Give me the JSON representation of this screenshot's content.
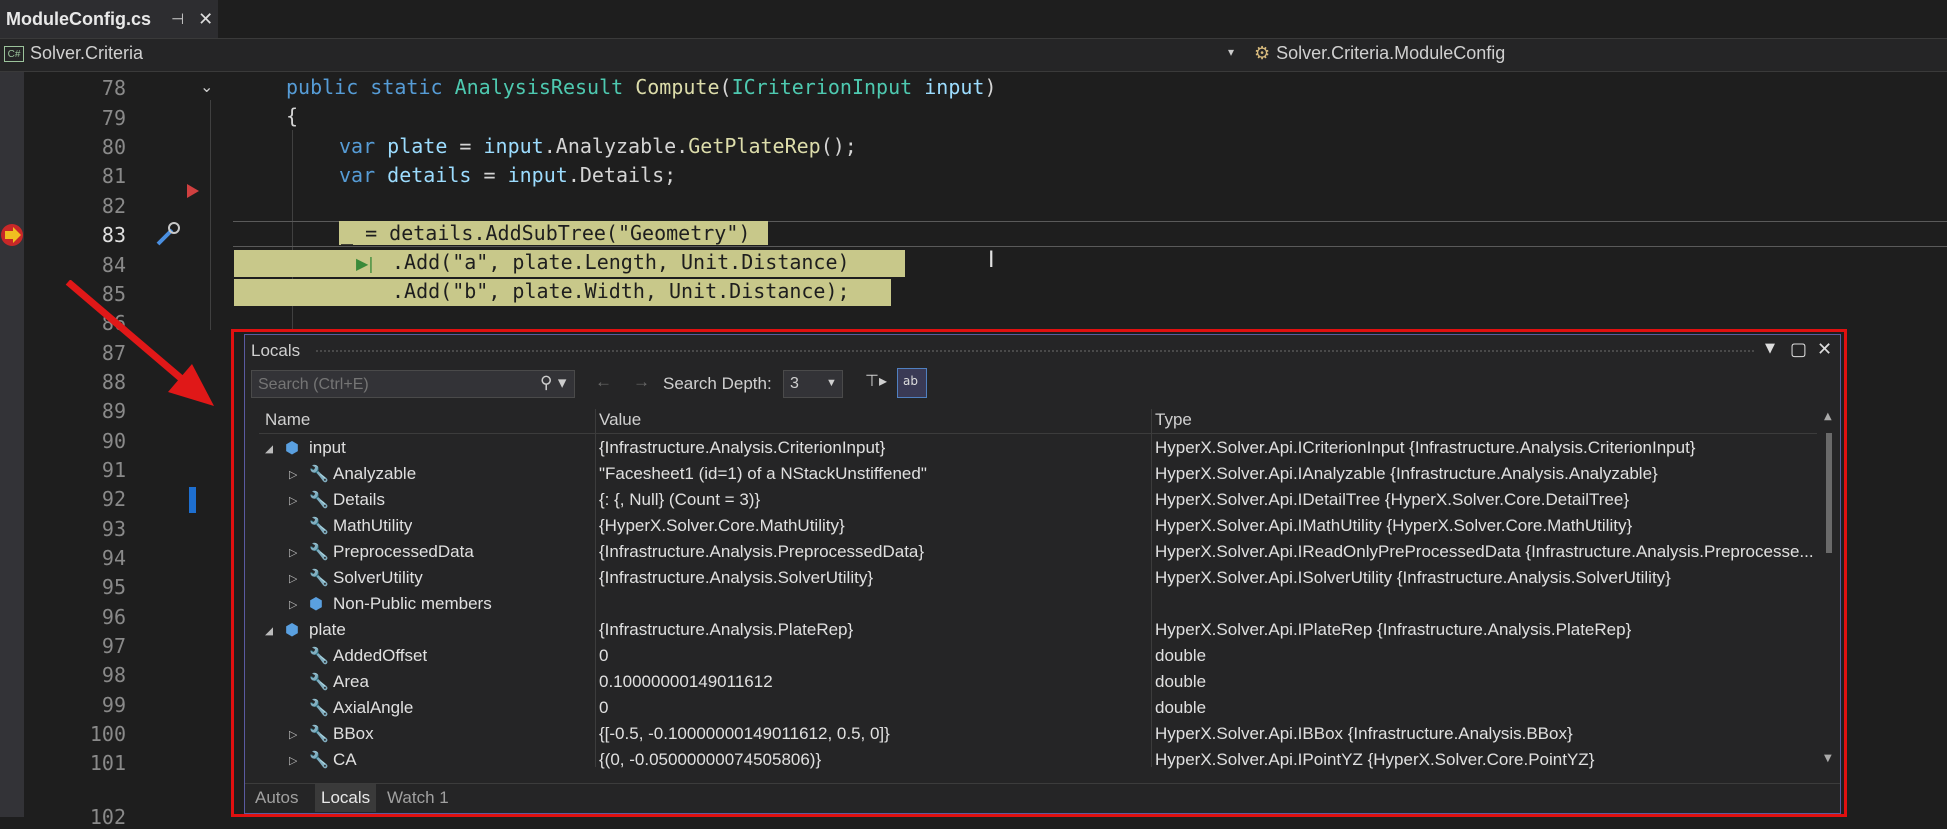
{
  "tab": {
    "title": "ModuleConfig.cs",
    "pin": "⊣",
    "close": "✕"
  },
  "navbar": {
    "left": "Solver.Criteria",
    "dropdown": "▾",
    "right": "Solver.Criteria.ModuleConfig"
  },
  "lines": [
    "78",
    "79",
    "80",
    "81",
    "82",
    "83",
    "84",
    "85",
    "86",
    "87",
    "88",
    "89",
    "90",
    "91",
    "92",
    "93",
    "94",
    "95",
    "96",
    "97",
    "98",
    "99",
    "100",
    "101",
    "102"
  ],
  "code": {
    "l78": {
      "kw1": "public",
      "kw2": "static",
      "type": "AnalysisResult",
      "fn": "Compute",
      "p1": "(",
      "ptype": "ICriterionInput",
      "pname": "input",
      "p2": ")"
    },
    "l79": "{",
    "l80": {
      "kw": "var",
      "var": "plate",
      "eq": " = ",
      "obj": "input",
      "rest": ".Analyzable.",
      "fn": "GetPlateRep",
      "end": "();"
    },
    "l81": {
      "kw": "var",
      "var": "details",
      "eq": " = ",
      "obj": "input",
      "rest": ".Details;"
    },
    "l83": "_ = details.AddSubTree(\"Geometry\")",
    "l84": ".Add(\"a\", plate.Length, Unit.Distance)",
    "l85": ".Add(\"b\", plate.Width, Unit.Distance);"
  },
  "locals": {
    "title": "Locals",
    "search_placeholder": "Search (Ctrl+E)",
    "search_depth_label": "Search Depth:",
    "search_depth_value": "3",
    "columns": {
      "name": "Name",
      "value": "Value",
      "type": "Type"
    },
    "rows": [
      {
        "name": "input",
        "value": "{Infrastructure.Analysis.CriterionInput}",
        "type": "HyperX.Solver.Api.ICriterionInput {Infrastructure.Analysis.CriterionInput}"
      },
      {
        "name": "Analyzable",
        "value": "\"Facesheet1 (id=1) of a NStackUnstiffened\"",
        "type": "HyperX.Solver.Api.IAnalyzable {Infrastructure.Analysis.Analyzable}"
      },
      {
        "name": "Details",
        "value": "{: {, Null} (Count = 3)}",
        "type": "HyperX.Solver.Api.IDetailTree {HyperX.Solver.Core.DetailTree}"
      },
      {
        "name": "MathUtility",
        "value": "{HyperX.Solver.Core.MathUtility}",
        "type": "HyperX.Solver.Api.IMathUtility {HyperX.Solver.Core.MathUtility}"
      },
      {
        "name": "PreprocessedData",
        "value": "{Infrastructure.Analysis.PreprocessedData}",
        "type": "HyperX.Solver.Api.IReadOnlyPreProcessedData {Infrastructure.Analysis.Preprocesse..."
      },
      {
        "name": "SolverUtility",
        "value": "{Infrastructure.Analysis.SolverUtility}",
        "type": "HyperX.Solver.Api.ISolverUtility {Infrastructure.Analysis.SolverUtility}"
      },
      {
        "name": "Non-Public members",
        "value": "",
        "type": ""
      },
      {
        "name": "plate",
        "value": "{Infrastructure.Analysis.PlateRep}",
        "type": "HyperX.Solver.Api.IPlateRep {Infrastructure.Analysis.PlateRep}"
      },
      {
        "name": "AddedOffset",
        "value": "0",
        "type": "double"
      },
      {
        "name": "Area",
        "value": "0.10000000149011612",
        "type": "double"
      },
      {
        "name": "AxialAngle",
        "value": "0",
        "type": "double"
      },
      {
        "name": "BBox",
        "value": "{[-0.5, -0.10000000149011612, 0.5, 0]}",
        "type": "HyperX.Solver.Api.IBBox {Infrastructure.Analysis.BBox}"
      },
      {
        "name": "CA",
        "value": "{(0, -0.05000000074505806)}",
        "type": "HyperX.Solver.Api.IPointYZ {HyperX.Solver.Core.PointYZ}"
      }
    ],
    "bottom_tabs": [
      "Autos",
      "Locals",
      "Watch 1"
    ]
  }
}
